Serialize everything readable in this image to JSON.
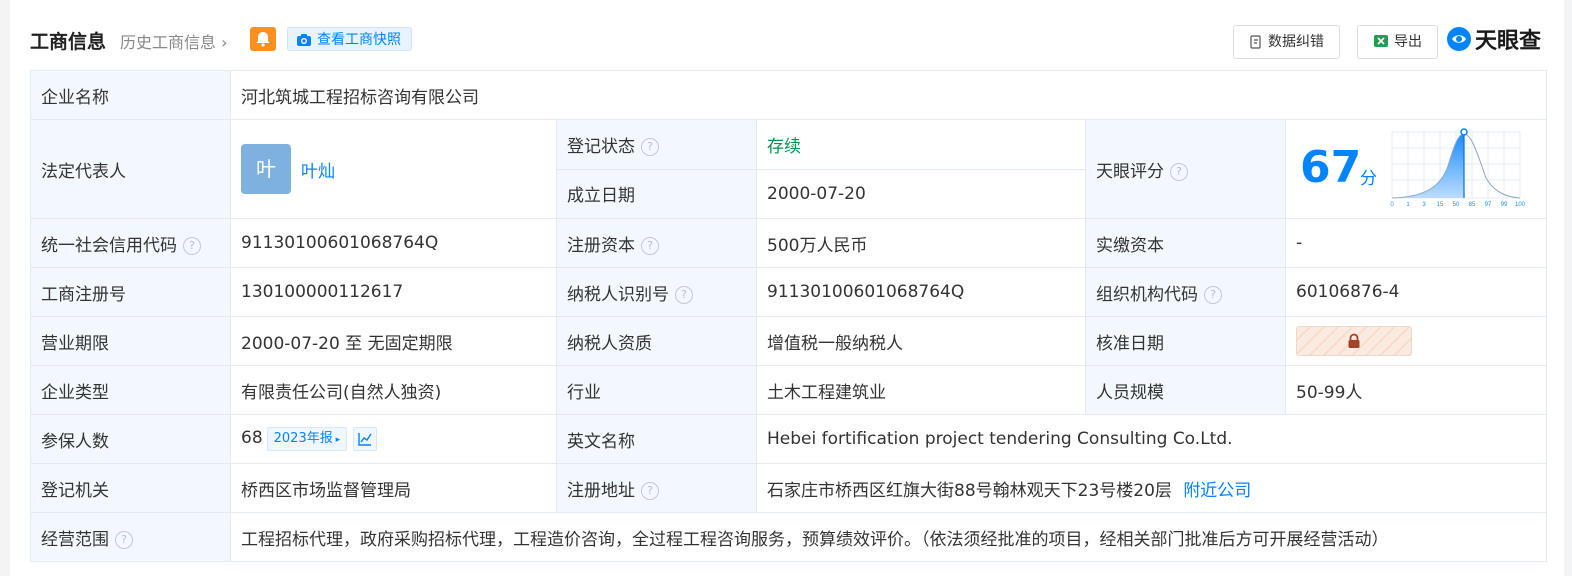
{
  "header": {
    "title": "工商信息",
    "history_link": "历史工商信息",
    "snapshot_button": "查看工商快照",
    "correction_button": "数据纠错",
    "export_button": "导出",
    "brand": "天眼查"
  },
  "colors": {
    "accent": "#0084ff",
    "status_green": "#00964f",
    "label_bg": "#f2f8fe",
    "bell_orange": "#ff8f1f"
  },
  "company_name": {
    "label": "企业名称",
    "value": "河北筑城工程招标咨询有限公司"
  },
  "legal_rep": {
    "label": "法定代表人",
    "avatar_char": "叶",
    "name": "叶灿"
  },
  "reg_status": {
    "label": "登记状态",
    "value": "存续"
  },
  "found_date": {
    "label": "成立日期",
    "value": "2000-07-20"
  },
  "score": {
    "label": "天眼评分",
    "value": "67",
    "unit": "分",
    "axis_ticks": [
      "0",
      "1",
      "3",
      "15",
      "50",
      "85",
      "97",
      "99",
      "100"
    ]
  },
  "credit_code": {
    "label": "统一社会信用代码",
    "value": "91130100601068764Q"
  },
  "reg_capital": {
    "label": "注册资本",
    "value": "500万人民币"
  },
  "paid_capital": {
    "label": "实缴资本",
    "value": "-"
  },
  "reg_no": {
    "label": "工商注册号",
    "value": "130100000112617"
  },
  "taxpayer_id": {
    "label": "纳税人识别号",
    "value": "91130100601068764Q"
  },
  "org_code": {
    "label": "组织机构代码",
    "value": "60106876-4"
  },
  "term": {
    "label": "营业期限",
    "value": "2000-07-20 至 无固定期限"
  },
  "taxpayer_qual": {
    "label": "纳税人资质",
    "value": "增值税一般纳税人"
  },
  "approve_date": {
    "label": "核准日期"
  },
  "company_type": {
    "label": "企业类型",
    "value": "有限责任公司(自然人独资)"
  },
  "industry": {
    "label": "行业",
    "value": "土木工程建筑业"
  },
  "staff_size": {
    "label": "人员规模",
    "value": "50-99人"
  },
  "insured": {
    "label": "参保人数",
    "value": "68",
    "report_tag": "2023年报"
  },
  "english_name": {
    "label": "英文名称",
    "value": "Hebei fortification project tendering Consulting Co.Ltd."
  },
  "authority": {
    "label": "登记机关",
    "value": "桥西区市场监督管理局"
  },
  "address": {
    "label": "注册地址",
    "value": "石家庄市桥西区红旗大街88号翰林观天下23号楼20层",
    "nearby": "附近公司"
  },
  "scope": {
    "label": "经营范围",
    "value": "工程招标代理，政府采购招标代理，工程造价咨询，全过程工程咨询服务，预算绩效评价。（依法须经批准的项目，经相关部门批准后方可开展经营活动）"
  }
}
